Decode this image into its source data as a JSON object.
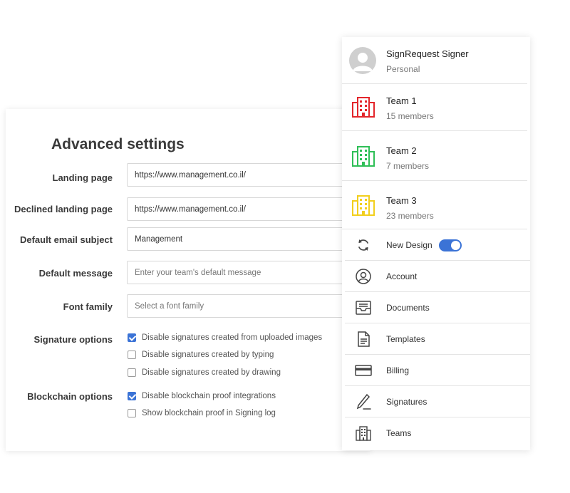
{
  "settings": {
    "title": "Advanced settings",
    "landing_page": {
      "label": "Landing page",
      "value": "https://www.management.co.il/"
    },
    "declined_landing_page": {
      "label": "Declined landing page",
      "value": "https://www.management.co.il/"
    },
    "default_email_subject": {
      "label": "Default email subject",
      "value": "Management"
    },
    "default_message": {
      "label": "Default message",
      "placeholder": "Enter your team's default message"
    },
    "font_family": {
      "label": "Font family",
      "placeholder": "Select a font family"
    },
    "signature_options": {
      "label": "Signature options",
      "items": [
        {
          "label": "Disable signatures created from uploaded images",
          "checked": true
        },
        {
          "label": "Disable signatures created by typing",
          "checked": false
        },
        {
          "label": "Disable signatures created by drawing",
          "checked": false
        }
      ]
    },
    "blockchain_options": {
      "label": "Blockchain options",
      "items": [
        {
          "label": "Disable blockchain proof integrations",
          "checked": true
        },
        {
          "label": "Show blockchain proof in Signing log",
          "checked": false
        }
      ]
    }
  },
  "menu": {
    "profiles": [
      {
        "name": "SignRequest Signer",
        "sub": "Personal",
        "icon": "avatar"
      },
      {
        "name": "Team 1",
        "sub": "15 members",
        "icon": "building-icon",
        "color": "#e3262b"
      },
      {
        "name": "Team 2",
        "sub": "7 members",
        "icon": "building-icon",
        "color": "#2fbf57"
      },
      {
        "name": "Team 3",
        "sub": "23 members",
        "icon": "building-icon",
        "color": "#f2cf1d"
      }
    ],
    "items": [
      {
        "label": "New Design",
        "icon": "refresh-icon",
        "toggle_on": true
      },
      {
        "label": "Account",
        "icon": "user-icon"
      },
      {
        "label": "Documents",
        "icon": "inbox-icon"
      },
      {
        "label": "Templates",
        "icon": "document-icon"
      },
      {
        "label": "Billing",
        "icon": "credit-card-icon"
      },
      {
        "label": "Signatures",
        "icon": "pen-icon"
      },
      {
        "label": "Teams",
        "icon": "buildings-icon"
      }
    ]
  },
  "colors": {
    "accent": "#3b73d6",
    "border": "#d7d7d7",
    "divider": "#e4e4e4"
  }
}
